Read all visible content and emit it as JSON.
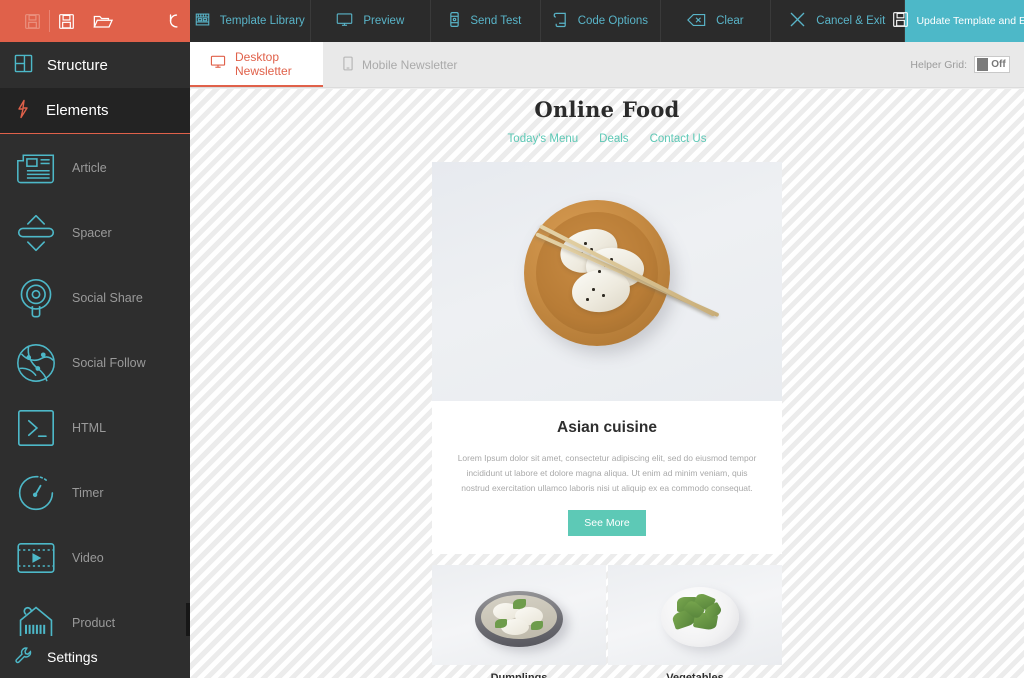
{
  "toolbar": {
    "file_actions": [
      {
        "name": "save-icon",
        "label": "Save",
        "disabled": true
      },
      {
        "name": "save-as-icon",
        "label": "Save As",
        "disabled": false
      },
      {
        "name": "open-folder-icon",
        "label": "Open",
        "disabled": false
      },
      {
        "name": "undo-icon",
        "label": "Undo",
        "disabled": false
      }
    ],
    "items": [
      {
        "icon": "template-library-icon",
        "label": "Template Library"
      },
      {
        "icon": "monitor-preview-icon",
        "label": "Preview"
      },
      {
        "icon": "send-test-icon",
        "label": "Send Test"
      },
      {
        "icon": "code-options-icon",
        "label": "Code Options"
      },
      {
        "icon": "clear-icon",
        "label": "Clear"
      },
      {
        "icon": "close-x-icon",
        "label": "Cancel & Exit"
      }
    ],
    "update_button": {
      "icon": "save-disk-icon",
      "label": "Update Template and Exit"
    },
    "colors": {
      "red": "#e0614a",
      "dark": "#2b2b2b",
      "teal": "#4db8c8",
      "link": "#59b4c8"
    }
  },
  "sidebar": {
    "structure": {
      "icon": "structure-icon",
      "label": "Structure"
    },
    "elements": {
      "icon": "lightning-bolt-icon",
      "label": "Elements"
    },
    "settings": {
      "icon": "wrench-icon",
      "label": "Settings"
    },
    "items": [
      {
        "icon": "article-icon",
        "label": "Article"
      },
      {
        "icon": "spacer-icon",
        "label": "Spacer"
      },
      {
        "icon": "social-share-icon",
        "label": "Social Share"
      },
      {
        "icon": "social-follow-icon",
        "label": "Social Follow"
      },
      {
        "icon": "html-icon",
        "label": "HTML"
      },
      {
        "icon": "timer-icon",
        "label": "Timer"
      },
      {
        "icon": "video-icon",
        "label": "Video"
      },
      {
        "icon": "product-tag-icon",
        "label": "Product"
      }
    ]
  },
  "tabs": [
    {
      "icon": "desktop-icon",
      "label": "Desktop Newsletter",
      "active": true
    },
    {
      "icon": "mobile-icon",
      "label": "Mobile Newsletter",
      "active": false
    }
  ],
  "helper_grid": {
    "label": "Helper Grid:",
    "state": "Off",
    "enabled": false
  },
  "newsletter": {
    "title": "Online Food",
    "nav": [
      "Today's Menu",
      "Deals",
      "Contact Us"
    ],
    "hero_alt": "dumplings-in-wooden-bowl-with-chopsticks",
    "card": {
      "title": "Asian cuisine",
      "body": "Lorem Ipsum dolor sit amet, consectetur adipiscing elit, sed do eiusmod tempor incididunt ut labore et dolore magna aliqua. Ut enim ad minim veniam, quis nostrud exercitation ullamco laboris nisi ut aliquip ex ea commodo consequat.",
      "button": "See More"
    },
    "tiles": [
      {
        "alt": "dumplings-in-grey-bowl",
        "caption": "Dumplings"
      },
      {
        "alt": "greens-salad-in-white-bowl",
        "caption": "Vegetables"
      }
    ],
    "colors": {
      "accent": "#5dc9b6",
      "heading": "#2b2b2b",
      "body_text": "#a9a9a9"
    }
  }
}
